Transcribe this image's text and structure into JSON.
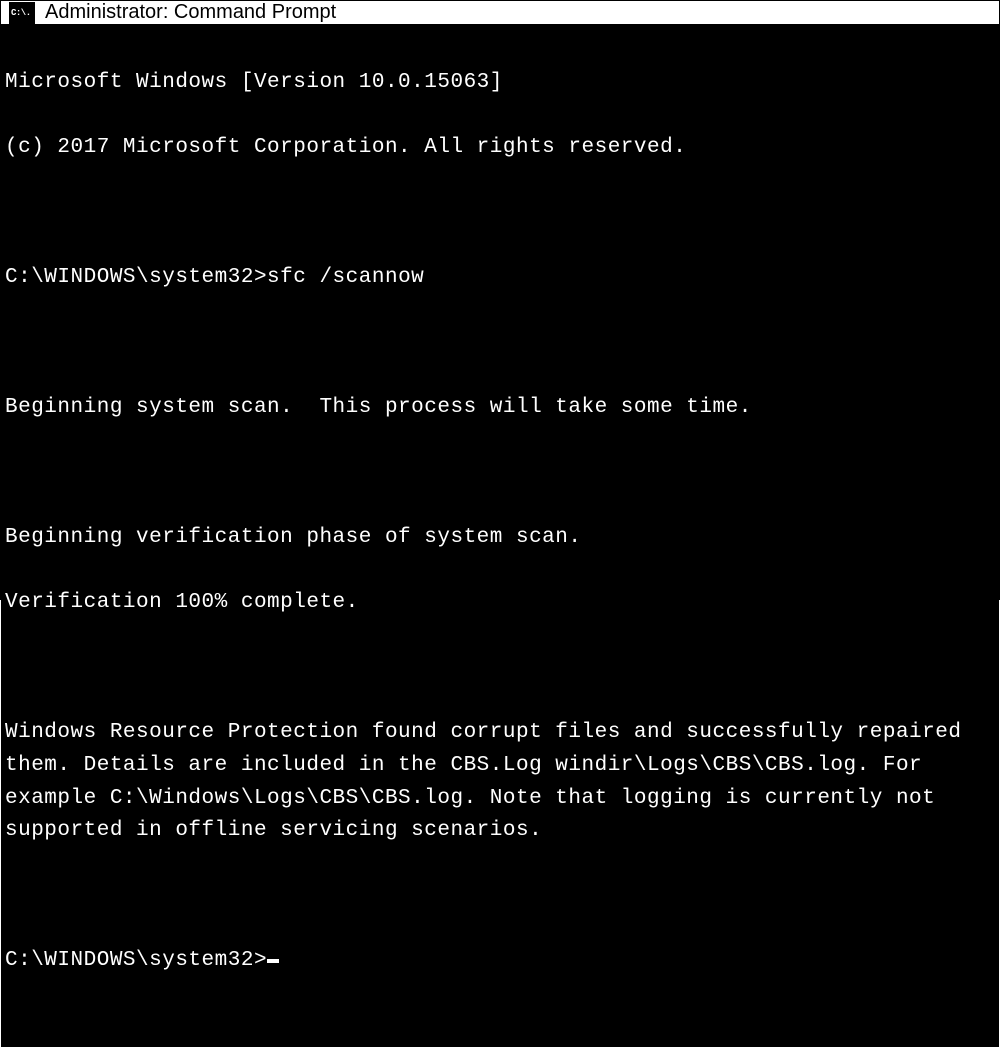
{
  "titlebar": {
    "icon_text": "C:\\.",
    "title": "Administrator: Command Prompt"
  },
  "terminal": {
    "banner_line1": "Microsoft Windows [Version 10.0.15063]",
    "banner_line2": "(c) 2017 Microsoft Corporation. All rights reserved.",
    "prompt1_path": "C:\\WINDOWS\\system32>",
    "prompt1_command": "sfc /scannow",
    "output_line1": "Beginning system scan.  This process will take some time.",
    "output_line2": "Beginning verification phase of system scan.",
    "output_line3": "Verification 100% complete.",
    "output_block": "Windows Resource Protection found corrupt files and successfully repaired them. Details are included in the CBS.Log windir\\Logs\\CBS\\CBS.log. For example C:\\Windows\\Logs\\CBS\\CBS.log. Note that logging is currently not supported in offline servicing scenarios.",
    "prompt2_path": "C:\\WINDOWS\\system32>"
  }
}
